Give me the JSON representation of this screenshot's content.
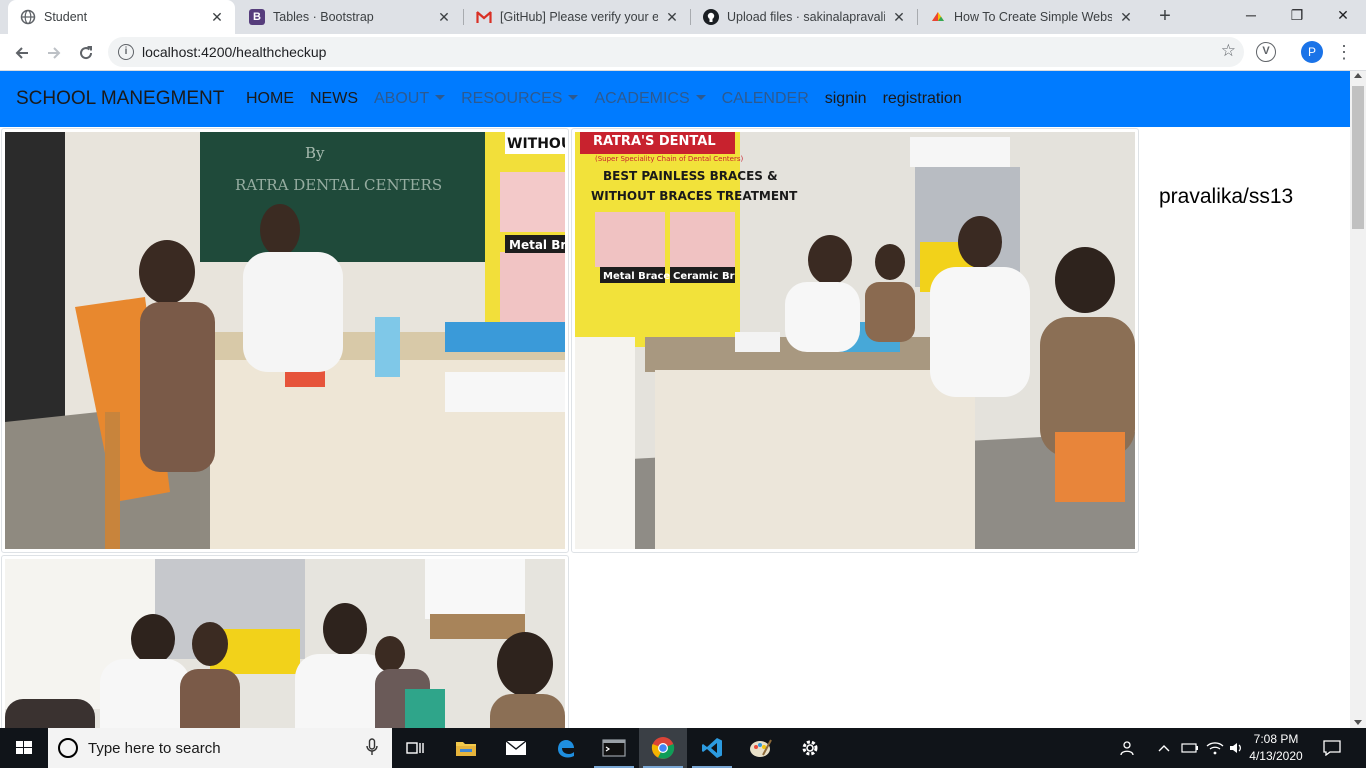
{
  "browser": {
    "tabs": [
      {
        "title": "Student",
        "icon": "globe-icon",
        "active": true
      },
      {
        "title": "Tables · Bootstrap",
        "icon": "bootstrap-icon",
        "active": false
      },
      {
        "title": "[GitHub] Please verify your em",
        "icon": "gmail-icon",
        "active": false
      },
      {
        "title": "Upload files · sakinalapravalika",
        "icon": "github-icon",
        "active": false
      },
      {
        "title": "How To Create Simple Website",
        "icon": "google-logo-icon",
        "active": false
      }
    ],
    "new_tab": "+",
    "url": "localhost:4200/healthcheckup",
    "profile_initial": "P",
    "extension_letter": "V"
  },
  "navbar": {
    "brand": "SCHOOL MANEGMENT",
    "items": [
      {
        "label": "HOME",
        "dropdown": false,
        "dim": false
      },
      {
        "label": "NEWS",
        "dropdown": false,
        "dim": false
      },
      {
        "label": "ABOUT",
        "dropdown": true,
        "dim": true
      },
      {
        "label": "RESOURCES",
        "dropdown": true,
        "dim": true
      },
      {
        "label": "ACADEMICS",
        "dropdown": true,
        "dim": true
      },
      {
        "label": "CALENDER",
        "dropdown": false,
        "dim": true
      },
      {
        "label": "signin",
        "dropdown": false,
        "dim": false
      },
      {
        "label": "registration",
        "dropdown": false,
        "dim": false
      }
    ],
    "color": "#007bff"
  },
  "content": {
    "photos": [
      {
        "subject": "dental checkup photo 1"
      },
      {
        "subject": "dental checkup photo 2"
      },
      {
        "subject": "dental checkup photo 3"
      }
    ],
    "photo1_text": {
      "chalk": "By",
      "chalk2": "RATRA DENTAL CENTERS",
      "poster": "WITHOUT",
      "poster2": "Metal Bra"
    },
    "photo2_text": {
      "brand": "RATRA'S DENTAL",
      "tagline": "(Super Speciality Chain of Dental Centers)",
      "head1": "BEST PAINLESS BRACES &",
      "head2": "WITHOUT BRACES TREATMENT",
      "label1": "Metal Braces",
      "label2": "Ceramic Br"
    },
    "user_label": "pravalika/ss13"
  },
  "taskbar": {
    "search_placeholder": "Type here to search",
    "time": "7:08 PM",
    "date": "4/13/2020"
  }
}
